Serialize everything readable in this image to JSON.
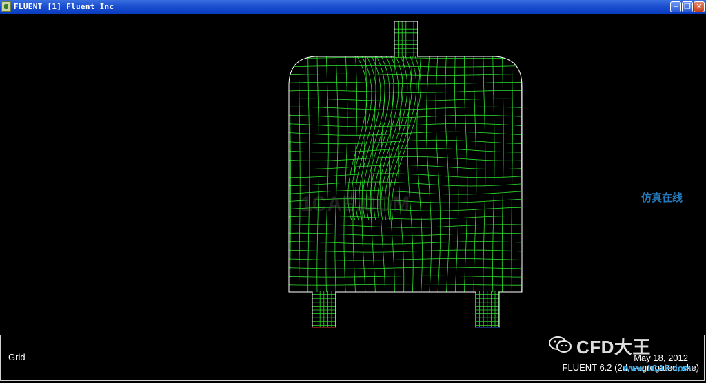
{
  "window": {
    "title": "FLUENT [1] Fluent Inc",
    "buttons": {
      "minimize_icon": "minimize-icon",
      "maximize_icon": "restore-icon",
      "close_icon": "close-icon"
    }
  },
  "plot": {
    "label": "Grid",
    "date": "May 18, 2012",
    "version": "FLUENT 6.2 (2d, segregated, ske)"
  },
  "watermarks": {
    "brand": "CFD大王",
    "center": "1CAE.COM",
    "corner": "仿真在线",
    "site": "www.1CAE.com"
  },
  "colors": {
    "mesh": "#2ee02e",
    "boundary": "#ffffff",
    "background": "#000000",
    "titlebar": "#1c4fd0"
  }
}
